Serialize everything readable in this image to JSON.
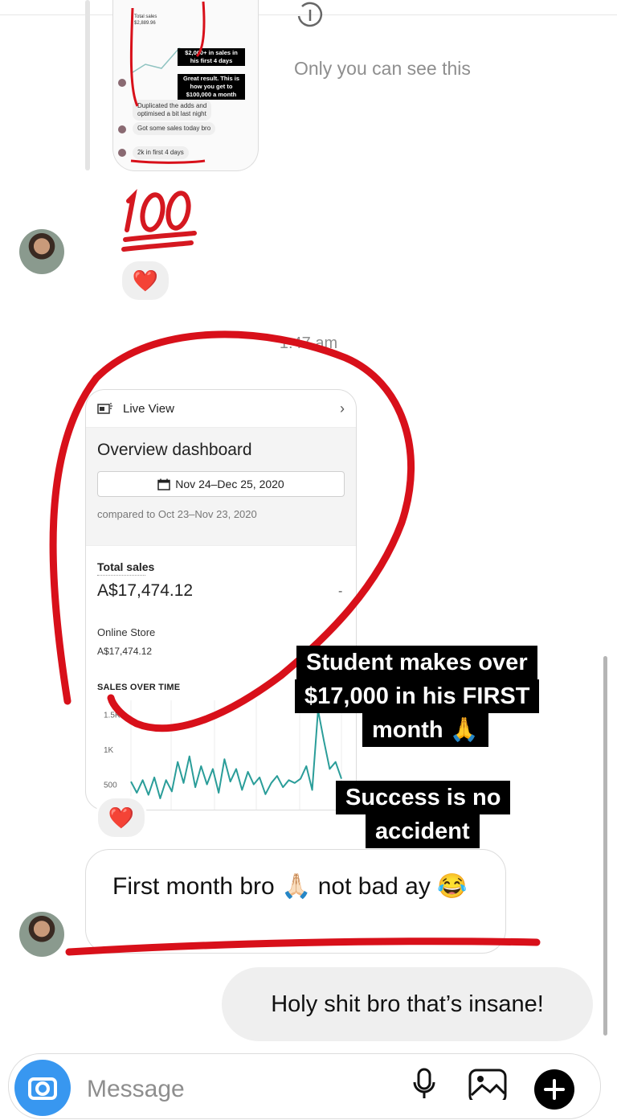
{
  "shared_post": {
    "mini_total_label": "Total sales",
    "mini_total_value": "$2,889.96",
    "tag1_line1": "$2,000+ in sales in",
    "tag1_line2": "his first 4 days",
    "tag2_line1": "Great result. This is",
    "tag2_line2": "how you get to",
    "tag2_line3": "$100,000 a month",
    "msg1_line1": "Duplicated the adds and",
    "msg1_line2": "optimised a bit last night",
    "msg2": "Got some sales today bro",
    "msg3": "2k in first 4 days"
  },
  "only_you_text": "Only you can see this",
  "reaction_heart": "❤️",
  "timestamp": "1:47 am",
  "dashboard": {
    "live_view": "Live View",
    "title": "Overview dashboard",
    "date_range": "Nov 24–Dec 25, 2020",
    "compared": "compared to Oct 23–Nov 23, 2020",
    "total_sales_label": "Total sales",
    "total_sales_value": "A$17,474.12",
    "dash_symbol": "-",
    "online_store_label": "Online Store",
    "online_store_value": "A$17,474.12",
    "chart_label": "SALES OVER TIME",
    "ticks": [
      "1.5K",
      "1K",
      "500"
    ]
  },
  "chart_data": {
    "type": "line",
    "title": "SALES OVER TIME",
    "yticks": [
      "1.5K",
      "1K",
      "500"
    ],
    "ylim": [
      300,
      1700
    ],
    "series": [
      {
        "values": [
          540,
          380,
          560,
          350,
          600,
          300,
          560,
          400,
          820,
          520,
          900,
          460,
          760,
          500,
          720,
          380,
          860,
          540,
          720,
          420,
          680,
          500,
          600,
          360,
          520,
          620,
          460,
          560,
          520,
          580,
          760,
          420,
          1560,
          1120,
          720,
          820,
          580
        ]
      }
    ]
  },
  "overlay": {
    "tag1_line1": "Student makes over",
    "tag1_line2": "$17,000 in his FIRST",
    "tag1_line3": "month 🙏",
    "tag2_line1": "Success is no",
    "tag2_line2": "accident"
  },
  "incoming_message": "First month bro 🙏🏻 not bad ay 😂",
  "outgoing_message": "Holy shit bro that’s insane!",
  "composer": {
    "placeholder": "Message"
  },
  "colors": {
    "accent_blue": "#3897f0",
    "annotation_red": "#d8101a",
    "chart_line": "#2a9d99"
  }
}
